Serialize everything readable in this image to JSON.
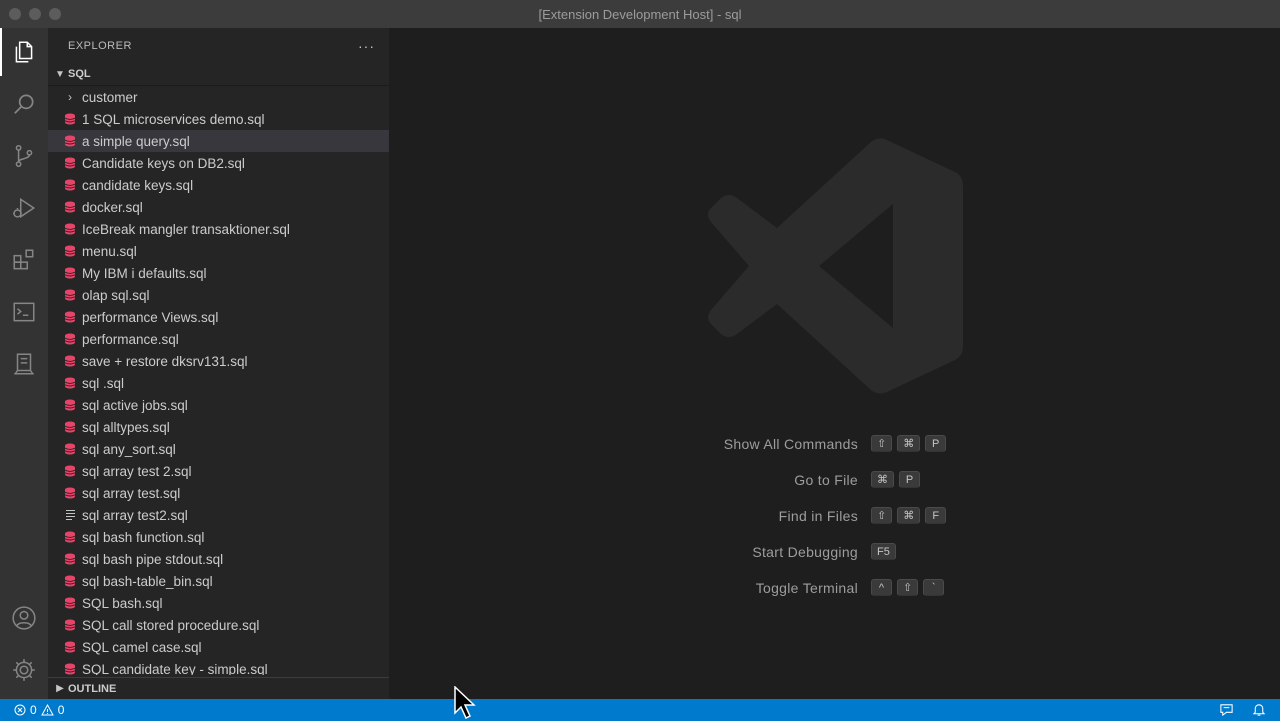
{
  "window": {
    "title": "[Extension Development Host] - sql"
  },
  "activity_bar": {
    "items": [
      "explorer-icon",
      "search-icon",
      "source-control-icon",
      "run-debug-icon",
      "extensions-icon",
      "terminal-icon",
      "remote-explorer-icon"
    ],
    "bottom": [
      "account-icon",
      "gear-icon"
    ]
  },
  "sidebar": {
    "title": "EXPLORER",
    "more": "···",
    "section": "SQL",
    "folder": "customer",
    "files": [
      "1 SQL microservices demo.sql",
      "a simple query.sql",
      "Candidate keys on DB2.sql",
      "candidate keys.sql",
      "docker.sql",
      "IceBreak mangler transaktioner.sql",
      "menu.sql",
      "My IBM i defaults.sql",
      "olap sql.sql",
      "performance Views.sql",
      "performance.sql",
      "save + restore dksrv131.sql",
      "sql .sql",
      "sql active jobs.sql",
      "sql alltypes.sql",
      "sql any_sort.sql",
      "sql array test 2.sql",
      "sql array test.sql",
      "sql array test2.sql",
      "sql bash function.sql",
      "sql bash pipe stdout.sql",
      "sql bash-table_bin.sql",
      "SQL bash.sql",
      "SQL call stored procedure.sql",
      "SQL camel case.sql",
      "SQL candidate key - simple.sql"
    ],
    "selected_file": "a simple query.sql",
    "outline": "OUTLINE"
  },
  "shortcuts": [
    {
      "label": "Show All Commands",
      "keys": [
        "⇧",
        "⌘",
        "P"
      ]
    },
    {
      "label": "Go to File",
      "keys": [
        "⌘",
        "P"
      ]
    },
    {
      "label": "Find in Files",
      "keys": [
        "⇧",
        "⌘",
        "F"
      ]
    },
    {
      "label": "Start Debugging",
      "keys": [
        "F5"
      ]
    },
    {
      "label": "Toggle Terminal",
      "keys": [
        "^",
        "⇧",
        "`"
      ]
    }
  ],
  "status_bar": {
    "errors": "0",
    "warnings": "0"
  },
  "colors": {
    "status_bar": "#007acc",
    "sql_icon": "#e8446a",
    "sidebar": "#252526",
    "editor": "#1e1e1e"
  }
}
